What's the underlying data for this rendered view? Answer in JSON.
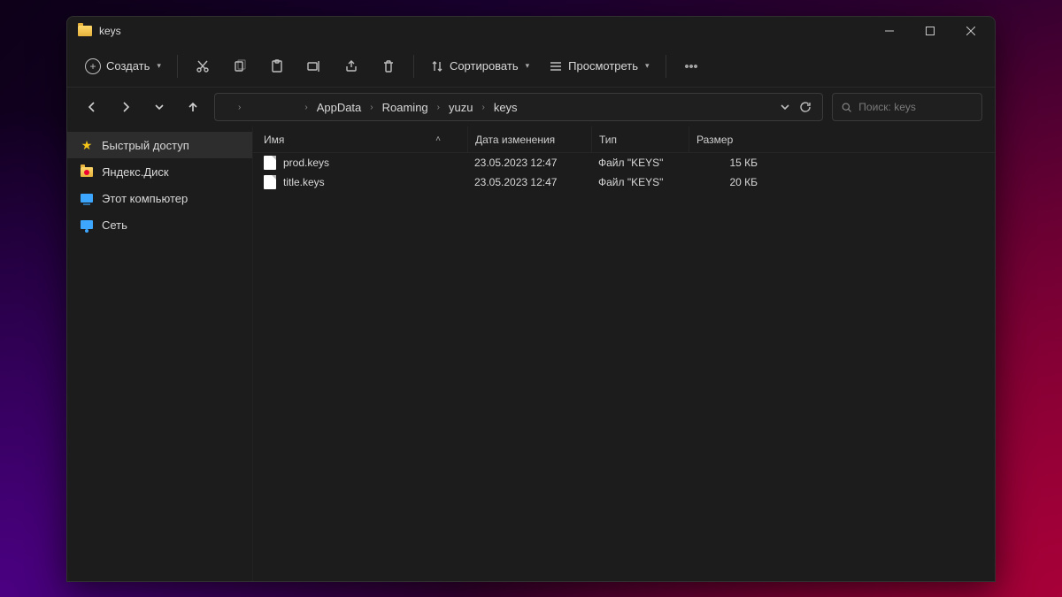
{
  "title": "keys",
  "toolbar": {
    "new_label": "Создать",
    "sort_label": "Сортировать",
    "view_label": "Просмотреть"
  },
  "breadcrumbs": [
    "AppData",
    "Roaming",
    "yuzu",
    "keys"
  ],
  "search": {
    "placeholder": "Поиск: keys"
  },
  "sidebar": {
    "items": [
      {
        "label": "Быстрый доступ"
      },
      {
        "label": "Яндекс.Диск"
      },
      {
        "label": "Этот компьютер"
      },
      {
        "label": "Сеть"
      }
    ]
  },
  "columns": {
    "name": "Имя",
    "modified": "Дата изменения",
    "type": "Тип",
    "size": "Размер"
  },
  "files": [
    {
      "name": "prod.keys",
      "modified": "23.05.2023 12:47",
      "type": "Файл \"KEYS\"",
      "size": "15 КБ"
    },
    {
      "name": "title.keys",
      "modified": "23.05.2023 12:47",
      "type": "Файл \"KEYS\"",
      "size": "20 КБ"
    }
  ]
}
